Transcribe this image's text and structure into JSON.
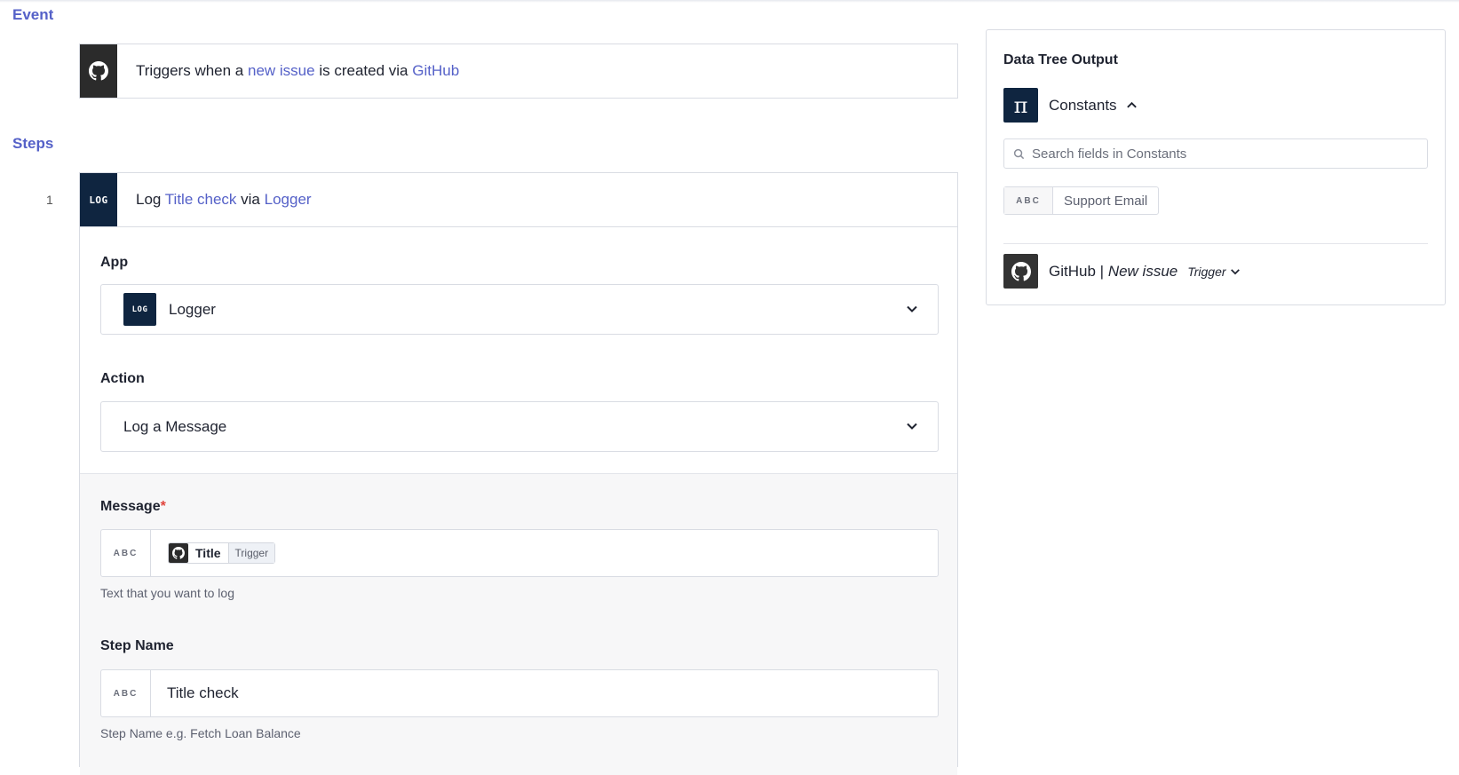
{
  "event": {
    "section_label": "Event",
    "prefix": "Triggers when a",
    "trigger_link": "new issue",
    "middle": "is created via",
    "app_link": "GitHub"
  },
  "steps": {
    "section_label": "Steps",
    "step_number": "1",
    "badge": "LOG",
    "title_prefix": "Log",
    "title_link": "Title check",
    "title_middle": "via",
    "app_link": "Logger"
  },
  "form": {
    "app_label": "App",
    "app_badge": "LOG",
    "app_value": "Logger",
    "action_label": "Action",
    "action_value": "Log a Message",
    "message_label": "Message",
    "required_mark": "*",
    "message_type": "ABC",
    "message_pill_title": "Title",
    "message_pill_source": "Trigger",
    "message_helper": "Text that you want to log",
    "step_name_label": "Step Name",
    "step_name_type": "ABC",
    "step_name_value": "Title check",
    "step_name_helper": "Step Name e.g. Fetch Loan Balance"
  },
  "panel": {
    "title": "Data Tree Output",
    "constants_label": "Constants",
    "constants_icon": "π",
    "search_placeholder": "Search fields in Constants",
    "tag_type": "ABC",
    "tag_label": "Support Email",
    "github_app": "GitHub",
    "github_separator": "|",
    "github_event": "New issue",
    "github_source": "Trigger"
  },
  "colors": {
    "accent": "#5561c8",
    "navy": "#0f2540",
    "github": "#2b2b2b",
    "required": "#e0443c"
  }
}
